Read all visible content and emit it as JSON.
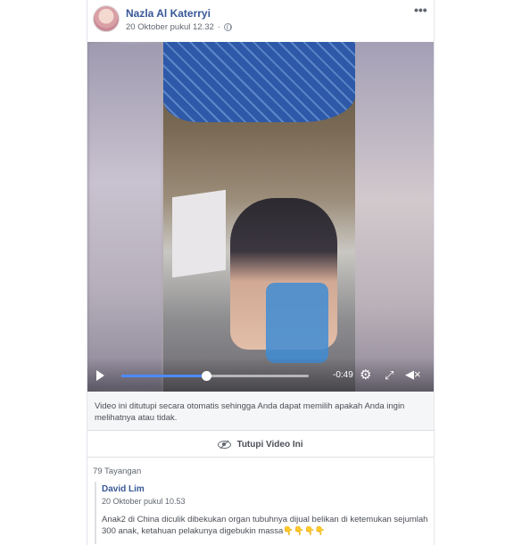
{
  "post": {
    "author": "Nazla Al Katerryi",
    "timestamp": "20 Oktober pukul 12.32",
    "privacy_icon": "globe-icon",
    "menu_icon": "more-options-icon",
    "menu_glyph": "•••"
  },
  "video": {
    "time_remaining": "-0:49",
    "progress": 0.45,
    "play_glyph": "",
    "settings_glyph": "⚙",
    "fullscreen_glyph": "⤢",
    "volume_glyph": "◀×"
  },
  "notice": {
    "text": "Video ini ditutupi secara otomatis sehingga Anda dapat memilih apakah Anda ingin melihatnya atau tidak."
  },
  "hide_button": {
    "label": "Tutupi Video Ini"
  },
  "views": "79 Tayangan",
  "shared": {
    "author": "David Lim",
    "timestamp": "20 Oktober pukul 10.53",
    "text": "Anak2 di China diculik dibekukan organ tubuhnya dijual belikan di ketemukan sejumlah 300 anak, ketahuan pelakunya digebukin massa",
    "emoji": "👇👇👇👇"
  },
  "colors": {
    "link": "#385898",
    "progress": "#4b8bff",
    "notice_bg": "#f5f6f7"
  }
}
